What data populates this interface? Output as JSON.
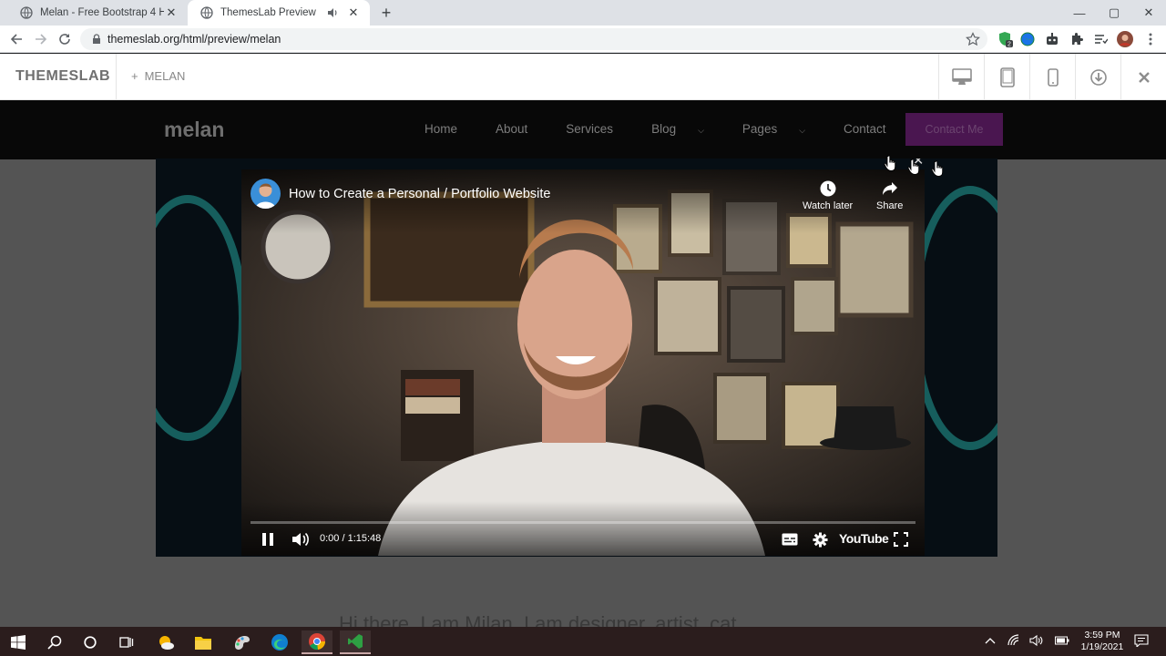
{
  "browser": {
    "tabs": [
      {
        "title": "Melan - Free Bootstrap 4 HTML5",
        "active": false
      },
      {
        "title": "ThemesLab Preview",
        "active": true
      }
    ],
    "url": "themeslab.org/html/preview/melan",
    "extension_badge": "2"
  },
  "preview_bar": {
    "brand": "THEMESLAB",
    "theme_plus": "+",
    "theme_name": "MELAN",
    "buttons": [
      "desktop-icon",
      "tablet-icon",
      "mobile-icon",
      "download-icon",
      "close-icon"
    ]
  },
  "site": {
    "logo": "melan",
    "menu": [
      {
        "label": "Home",
        "caret": ""
      },
      {
        "label": "About",
        "caret": ""
      },
      {
        "label": "Services",
        "caret": ""
      },
      {
        "label": "Blog",
        "caret": "⌵"
      },
      {
        "label": "Pages",
        "caret": "⌵"
      },
      {
        "label": "Contact",
        "caret": ""
      }
    ],
    "contact_button": "Contact Me",
    "hero_text": "Hi there, I am Milan, I am designer, artist, cat"
  },
  "video": {
    "title": "How to Create a Personal / Portfolio Website",
    "watch_later": "Watch later",
    "share": "Share",
    "time": "0:00 / 1:15:48",
    "logo": "YouTube",
    "progress": 0,
    "state": "playing"
  },
  "taskbar": {
    "time": "3:59 PM",
    "date": "1/19/2021"
  },
  "colors": {
    "accent": "#4a1650",
    "page_overlay": "#545454",
    "taskbar": "#2b1d1d"
  }
}
